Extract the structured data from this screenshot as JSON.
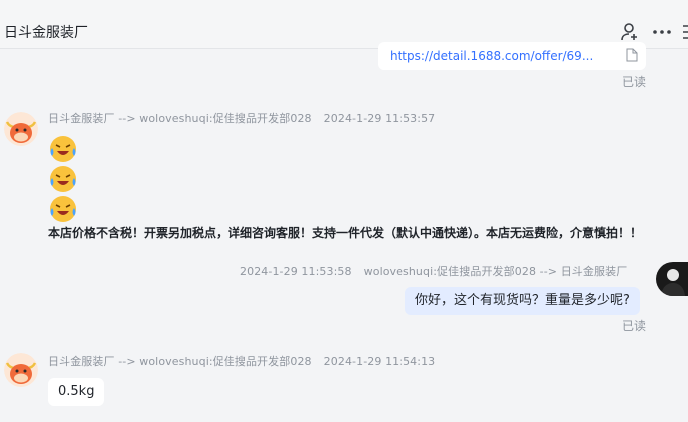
{
  "header": {
    "title": "日斗金服装厂",
    "icons": [
      "user-add-icon",
      "more-icon",
      "panel-icon"
    ]
  },
  "messages": [
    {
      "type": "link",
      "text": "https://detail.1688.com/offer/69...",
      "status": "已读"
    },
    {
      "meta": "日斗金服装厂 --> woloveshuqi:促佳搜品开发部028",
      "time": "2024-1-29 11:53:57",
      "emojis": [
        "laughing-crying-emoji",
        "laughing-crying-emoji",
        "laughing-crying-emoji"
      ],
      "text": "本店价格不含税！开票另加税点，详细咨询客服！支持一件代发（默认中通快递）。本店无运费险，介意慎拍！！"
    },
    {
      "meta": "woloveshuqi:促佳搜品开发部028 --> 日斗金服装厂",
      "time": "2024-1-29 11:53:58",
      "text": "你好，这个有现货吗？重量是多少呢?",
      "status": "已读"
    },
    {
      "meta": "日斗金服装厂 --> woloveshuqi:促佳搜品开发部028",
      "time": "2024-1-29 11:54:13",
      "text": "0.5kg"
    }
  ]
}
